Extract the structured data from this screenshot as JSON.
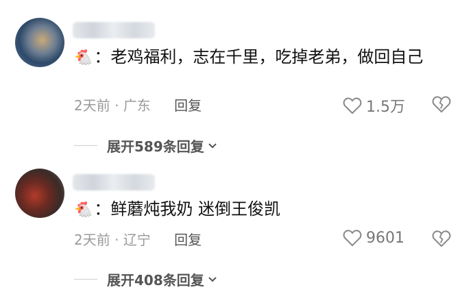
{
  "comments": [
    {
      "emoji": "🐔",
      "text": "：老鸡福利，志在千里，吃掉老弟，做回自己",
      "time": "2天前",
      "location": "广东",
      "reply_label": "回复",
      "likes": "1.5万",
      "expand_label": "展开589条回复"
    },
    {
      "emoji": "🐔",
      "text": "：鲜蘑炖我奶 迷倒王俊凯",
      "time": "2天前",
      "location": "辽宁",
      "reply_label": "回复",
      "likes": "9601",
      "expand_label": "展开408条回复"
    }
  ],
  "colors": {
    "meta": "#9a9a9a",
    "text": "#111111",
    "icon": "#8a8a8a"
  }
}
